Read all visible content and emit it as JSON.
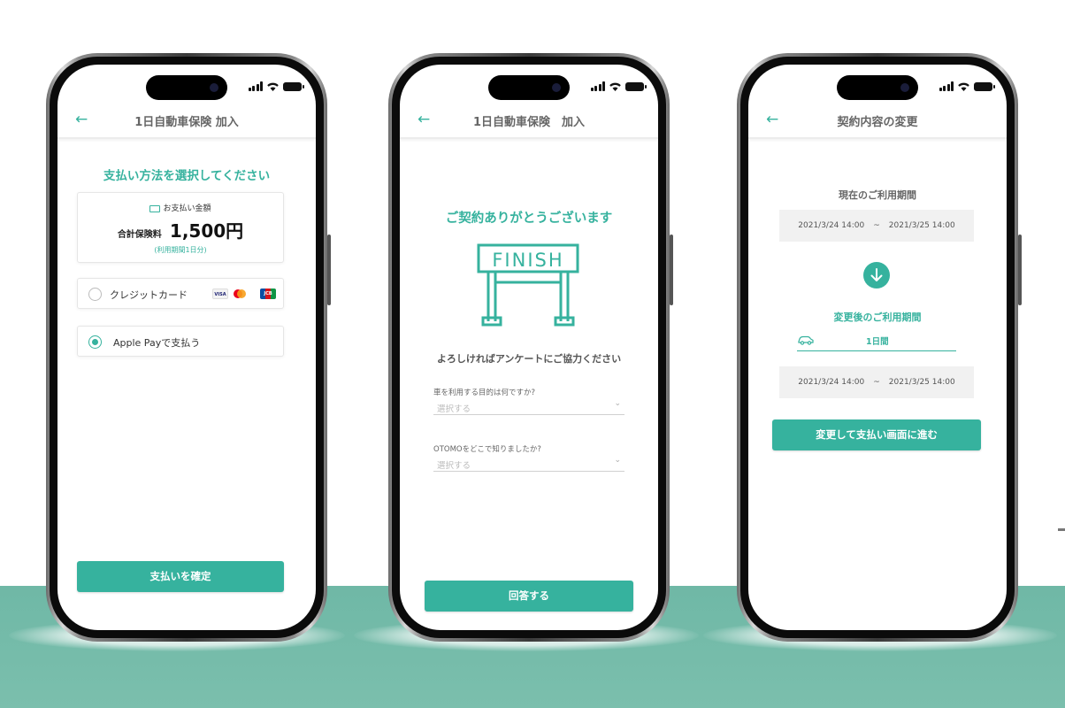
{
  "colors": {
    "accent": "#36b29e",
    "floor": "#73baa8"
  },
  "phone1": {
    "header_title": "1日自動車保険 加入",
    "heading": "支払い方法を選択してください",
    "amount_caption": "お支払い金額",
    "total_label": "合計保険料",
    "total_amount": "1,500円",
    "period_note": "(利用期間1日分)",
    "payment_options": [
      {
        "label": "クレジットカード",
        "selected": false
      },
      {
        "label": "Apple Payで支払う",
        "selected": true
      }
    ],
    "card_brands": [
      "VISA",
      "Mastercard",
      "JCB"
    ],
    "confirm_button": "支払いを確定"
  },
  "phone2": {
    "header_title": "1日自動車保険　加入",
    "heading": "ご契約ありがとうございます",
    "finish_sign": "FINISH",
    "survey_prompt": "よろしければアンケートにご協力ください",
    "q1_label": "車を利用する目的は何ですか?",
    "q1_placeholder": "選択する",
    "q2_label": "OTOMOをどこで知りましたか?",
    "q2_placeholder": "選択する",
    "answer_button": "回答する"
  },
  "phone3": {
    "header_title": "契約内容の変更",
    "current_label": "現在のご利用期間",
    "current_start": "2021/3/24 14:00",
    "current_sep": "~",
    "current_end": "2021/3/25 14:00",
    "after_label": "変更後のご利用期間",
    "duration_value": "1日間",
    "new_start": "2021/3/24 14:00",
    "new_sep": "~",
    "new_end": "2021/3/25 14:00",
    "proceed_button": "変更して支払い画面に進む"
  }
}
